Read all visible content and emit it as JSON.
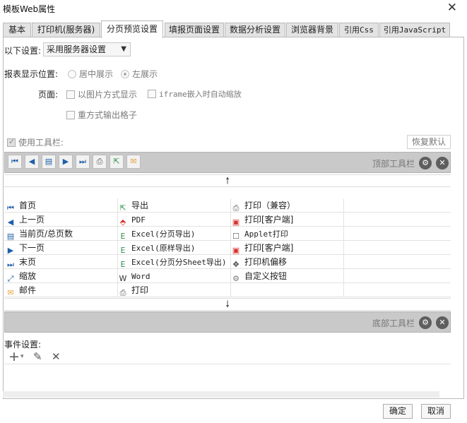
{
  "window": {
    "title": "模板Web属性",
    "close_glyph": "✕"
  },
  "tabs": [
    {
      "label": "基本"
    },
    {
      "label": "打印机(服务器)"
    },
    {
      "label": "分页预览设置"
    },
    {
      "label": "填报页面设置"
    },
    {
      "label": "数据分析设置"
    },
    {
      "label": "浏览器背景"
    },
    {
      "label": "引用Css"
    },
    {
      "label": "引用JavaScript"
    }
  ],
  "active_tab": "分页预览设置",
  "settings": {
    "label": "以下设置:",
    "select_value": "采用服务器设置",
    "report_position_label": "报表显示位置:",
    "center_option": "居中展示",
    "left_option": "左展示",
    "page_label": "页面:",
    "image_mode": "以图片方式显示",
    "iframe_auto_zoom": "iframe嵌入时自动缩放",
    "reuse_output_cells": "重方式输出格子"
  },
  "toolbar": {
    "use_toolbar_label": "使用工具栏:",
    "restore_default": "恢复默认",
    "top_toolbar_label": "顶部工具栏",
    "bottom_toolbar_label": "底部工具栏",
    "up_arrow": "🠕",
    "down_arrow": "🠗",
    "settings_glyph": "⚙",
    "remove_glyph": "✕"
  },
  "grid_items": [
    [
      "首页",
      "导出",
      "打印（兼容）"
    ],
    [
      "上一页",
      "PDF",
      "打印[客户端]"
    ],
    [
      "当前页/总页数",
      "Excel(分页导出)",
      "Applet打印"
    ],
    [
      "下一页",
      "Excel(原样导出)",
      "打印[客户端]"
    ],
    [
      "末页",
      "Excel(分页分Sheet导出)",
      "打印机偏移"
    ],
    [
      "缩放",
      "Word",
      "自定义按钮"
    ],
    [
      "邮件",
      "打印",
      ""
    ]
  ],
  "events": {
    "label": "事件设置:",
    "add_glyph": "+",
    "add_dropdown_glyph": "▾",
    "edit_glyph": "✎",
    "delete_glyph": "✕"
  },
  "footer": {
    "ok": "确定",
    "cancel": "取消"
  },
  "colors": {
    "pdf_red": "#d9302c",
    "excel_green": "#2f8f4e",
    "nav_blue": "#1f5fa8",
    "mail_orange": "#e8a23c"
  }
}
